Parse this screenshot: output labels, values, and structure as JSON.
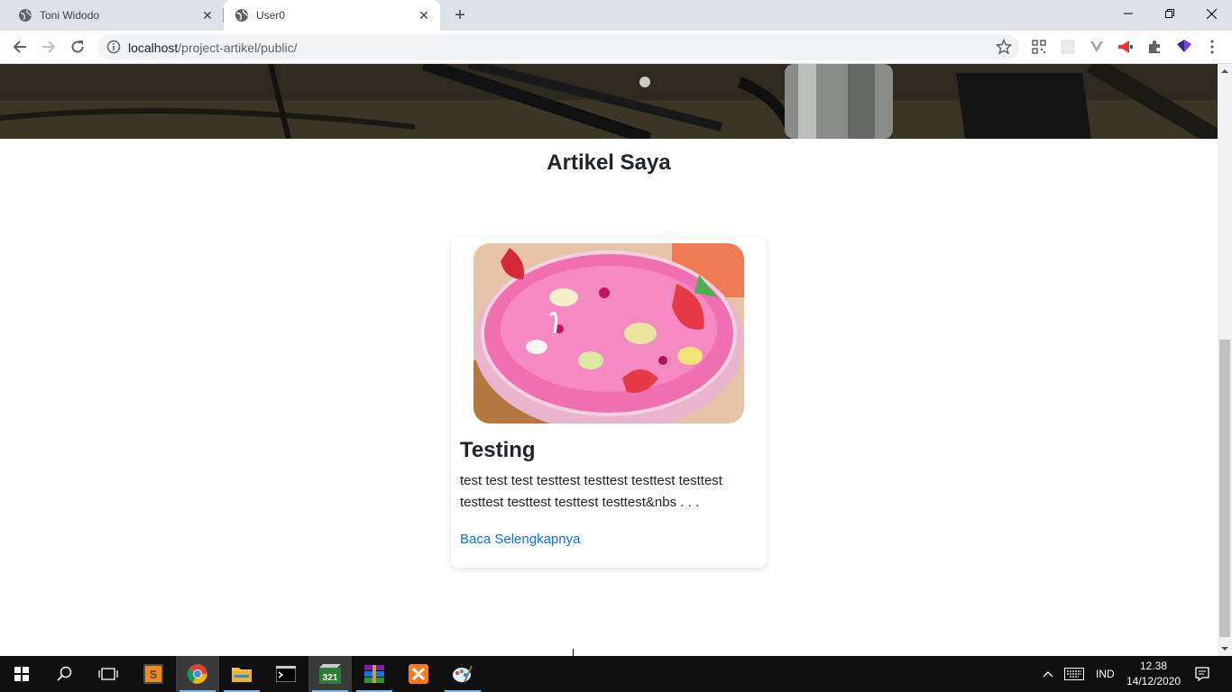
{
  "browser": {
    "tabs": [
      {
        "title": "Toni Widodo",
        "active": false
      },
      {
        "title": "User0",
        "active": true
      }
    ],
    "url_host": "localhost",
    "url_path": "/project-artikel/public/"
  },
  "page": {
    "title": "Artikel Saya",
    "card": {
      "title": "Testing",
      "excerpt": "test test test testtest testtest testtest testtest testtest testtest testtest testtest&nbs . . .",
      "link_label": "Baca Selengkapnya"
    }
  },
  "taskbar": {
    "language": "IND",
    "time": "12.38",
    "date": "14/12/2020"
  },
  "colors": {
    "link": "#0d6efd",
    "tabbar": "#dee1e6"
  }
}
